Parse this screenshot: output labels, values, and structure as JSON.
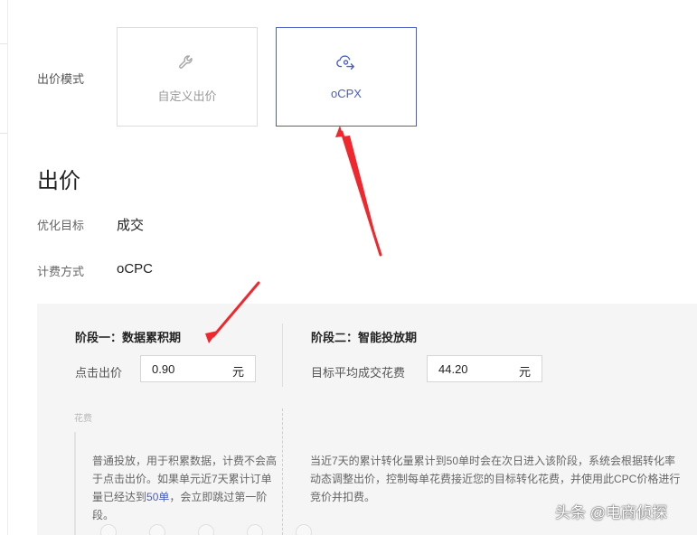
{
  "bid_mode": {
    "label": "出价模式",
    "options": [
      {
        "label": "自定义出价",
        "icon": "wrench-icon",
        "selected": false
      },
      {
        "label": "oCPX",
        "icon": "cloud-arrow-icon",
        "selected": true
      }
    ]
  },
  "bid_section": {
    "title": "出价",
    "goal_label": "优化目标",
    "goal_value": "成交",
    "billing_label": "计费方式",
    "billing_value": "oCPC"
  },
  "stages": {
    "stage1": {
      "title": "阶段一：数据累积期",
      "field_label": "点击出价",
      "value": "0.90",
      "unit": "元",
      "desc_part1": "普通投放，用于积累数据，计费不会高于点击出价。如果单元近7天累计订单量已经达到",
      "desc_highlight": "50单",
      "desc_part2": "，会立即跳过第一阶段。"
    },
    "stage2": {
      "title": "阶段二：智能投放期",
      "field_label": "目标平均成交花费",
      "value": "44.20",
      "unit": "元",
      "desc": "当近7天的累计转化量累计到50单时会在次日进入该阶段，系统会根据转化率动态调整出价，控制每单花费接近您的目标转化花费，并使用此CPC价格进行竞价并扣费。"
    },
    "fee_label": "花费"
  },
  "watermark": "头条 @电商侦探",
  "colors": {
    "accent": "#4a5fc1",
    "annotation": "#f0282d",
    "panel_bg": "#f5f5f5"
  }
}
